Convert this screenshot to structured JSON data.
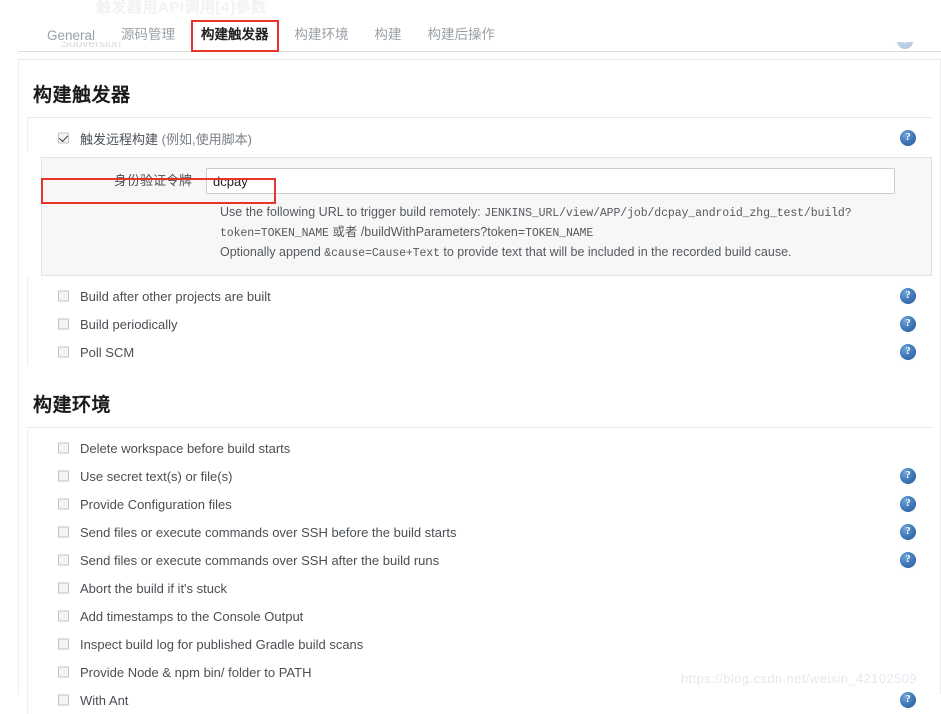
{
  "ghost_header": "触发器用API调用[4]参数",
  "tabs": [
    {
      "label": "General",
      "active": false
    },
    {
      "label": "源码管理",
      "active": false
    },
    {
      "label": "构建触发器",
      "active": true
    },
    {
      "label": "构建环境",
      "active": false
    },
    {
      "label": "构建",
      "active": false
    },
    {
      "label": "构建后操作",
      "active": false
    }
  ],
  "cut_row": {
    "label": "Subversion"
  },
  "build_triggers": {
    "title": "构建触发器",
    "remote": {
      "label_main": "触发远程构建",
      "label_note": "(例如,使用脚本)",
      "checked": true,
      "highlighted": true
    },
    "token": {
      "label": "身份验证令牌",
      "value": "dcpay",
      "placeholder": "",
      "help_line1_prefix": "Use the following URL to trigger build remotely:",
      "help_line1_url": "JENKINS_URL/view/APP/job/dcpay_android_zhg_test/build?",
      "help_line2_token": "token=TOKEN_NAME",
      "help_line2_mid": "或者",
      "help_line2_alt": "/buildWithParameters?token=",
      "help_line2_tail": "TOKEN_NAME",
      "help_line3_prefix": "Optionally append",
      "help_line3_param": "&cause=Cause+Text",
      "help_line3_suffix": "to provide text that will be included in the recorded build cause."
    },
    "options": [
      {
        "label": "Build after other projects are built",
        "checked": false,
        "help": true
      },
      {
        "label": "Build periodically",
        "checked": false,
        "help": true
      },
      {
        "label": "Poll SCM",
        "checked": false,
        "help": true
      }
    ]
  },
  "build_environment": {
    "title": "构建环境",
    "options": [
      {
        "label": "Delete workspace before build starts",
        "checked": false,
        "help": false
      },
      {
        "label": "Use secret text(s) or file(s)",
        "checked": false,
        "help": true
      },
      {
        "label": "Provide Configuration files",
        "checked": false,
        "help": true
      },
      {
        "label": "Send files or execute commands over SSH before the build starts",
        "checked": false,
        "help": true
      },
      {
        "label": "Send files or execute commands over SSH after the build runs",
        "checked": false,
        "help": true
      },
      {
        "label": "Abort the build if it's stuck",
        "checked": false,
        "help": false
      },
      {
        "label": "Add timestamps to the Console Output",
        "checked": false,
        "help": false
      },
      {
        "label": "Inspect build log for published Gradle build scans",
        "checked": false,
        "help": false
      },
      {
        "label": "Provide Node & npm bin/ folder to PATH",
        "checked": false,
        "help": false
      },
      {
        "label": "With Ant",
        "checked": false,
        "help": true
      }
    ]
  },
  "watermark": "https://blog.csdn.net/weixin_42102509",
  "colors": {
    "highlight": "#e8342a",
    "help_icon": "#3b74b4",
    "panel_bg": "#f7f7f7"
  }
}
